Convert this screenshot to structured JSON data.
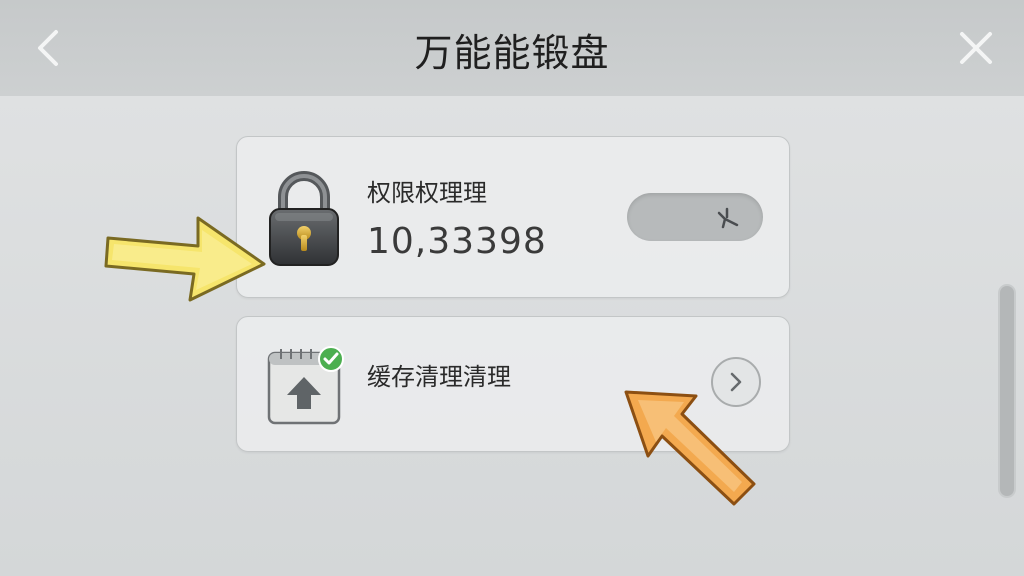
{
  "header": {
    "title": "万能能锻盘",
    "back_icon": "chevron-left-icon",
    "close_icon": "close-icon"
  },
  "cards": [
    {
      "label": "权限权理理",
      "value": "10,33398",
      "icon": "lock-icon",
      "control": "toggle-switch"
    },
    {
      "label": "缓存清理清理",
      "icon": "clipboard-upload-icon",
      "control": "chevron-right-icon"
    }
  ],
  "colors": {
    "background": "#d9dcdd",
    "header": "#c6c9ca",
    "highlight_arrow_1": "#f4e36a",
    "highlight_arrow_2": "#f2a74b",
    "badge_check": "#4caf50"
  }
}
